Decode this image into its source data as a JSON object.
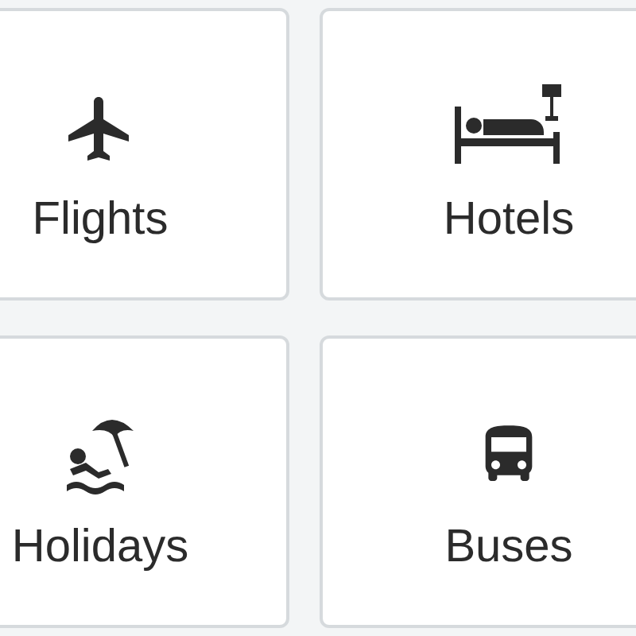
{
  "tiles": [
    {
      "kind": "plane",
      "label": "Flights"
    },
    {
      "kind": "bed",
      "label": "Hotels"
    },
    {
      "kind": "beach",
      "label": "Holidays"
    },
    {
      "kind": "bus",
      "label": "Buses"
    }
  ]
}
